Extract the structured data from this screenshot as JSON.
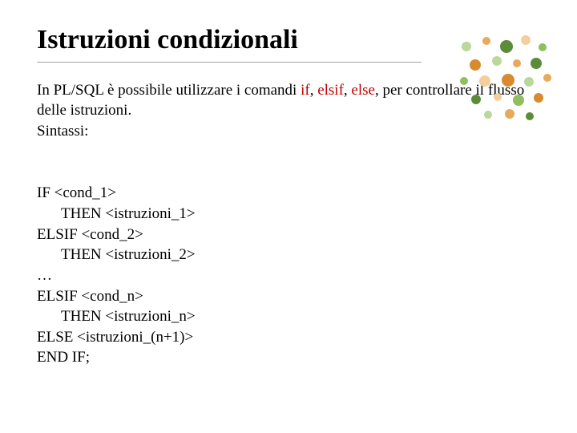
{
  "title": "Istruzioni condizionali",
  "intro_pre": "In PL/SQL è possibile utilizzare i comandi ",
  "kw_if": "if",
  "intro_sep1": ", ",
  "kw_elsif": "elsif",
  "intro_sep2": ", ",
  "kw_else": "else",
  "intro_post": ", per controllare il flusso delle istruzioni.",
  "intro_syntax": "Sintassi:",
  "code": {
    "l1a": "IF ",
    "l1b": "<cond_1>",
    "l2a": "THEN ",
    "l2b": "<istruzioni_1>",
    "l3a": "ELSIF ",
    "l3b": "<cond_2>",
    "l4a": "THEN ",
    "l4b": "<istruzioni_2>",
    "l5": "…",
    "l6a": "ELSIF ",
    "l6b": "<cond_n>",
    "l7a": "THEN ",
    "l7b": "<istruzioni_n>",
    "l8a": "ELSE ",
    "l8b": "<istruzioni_(n+1)>",
    "l9": "END IF;"
  },
  "colors": {
    "keyword": "#c00000",
    "dot_green_dark": "#5a8c3a",
    "dot_green": "#8fbf5f",
    "dot_green_light": "#b7d99a",
    "dot_orange_dark": "#d78a2e",
    "dot_orange": "#e9a85a",
    "dot_orange_light": "#f3cfa0"
  }
}
